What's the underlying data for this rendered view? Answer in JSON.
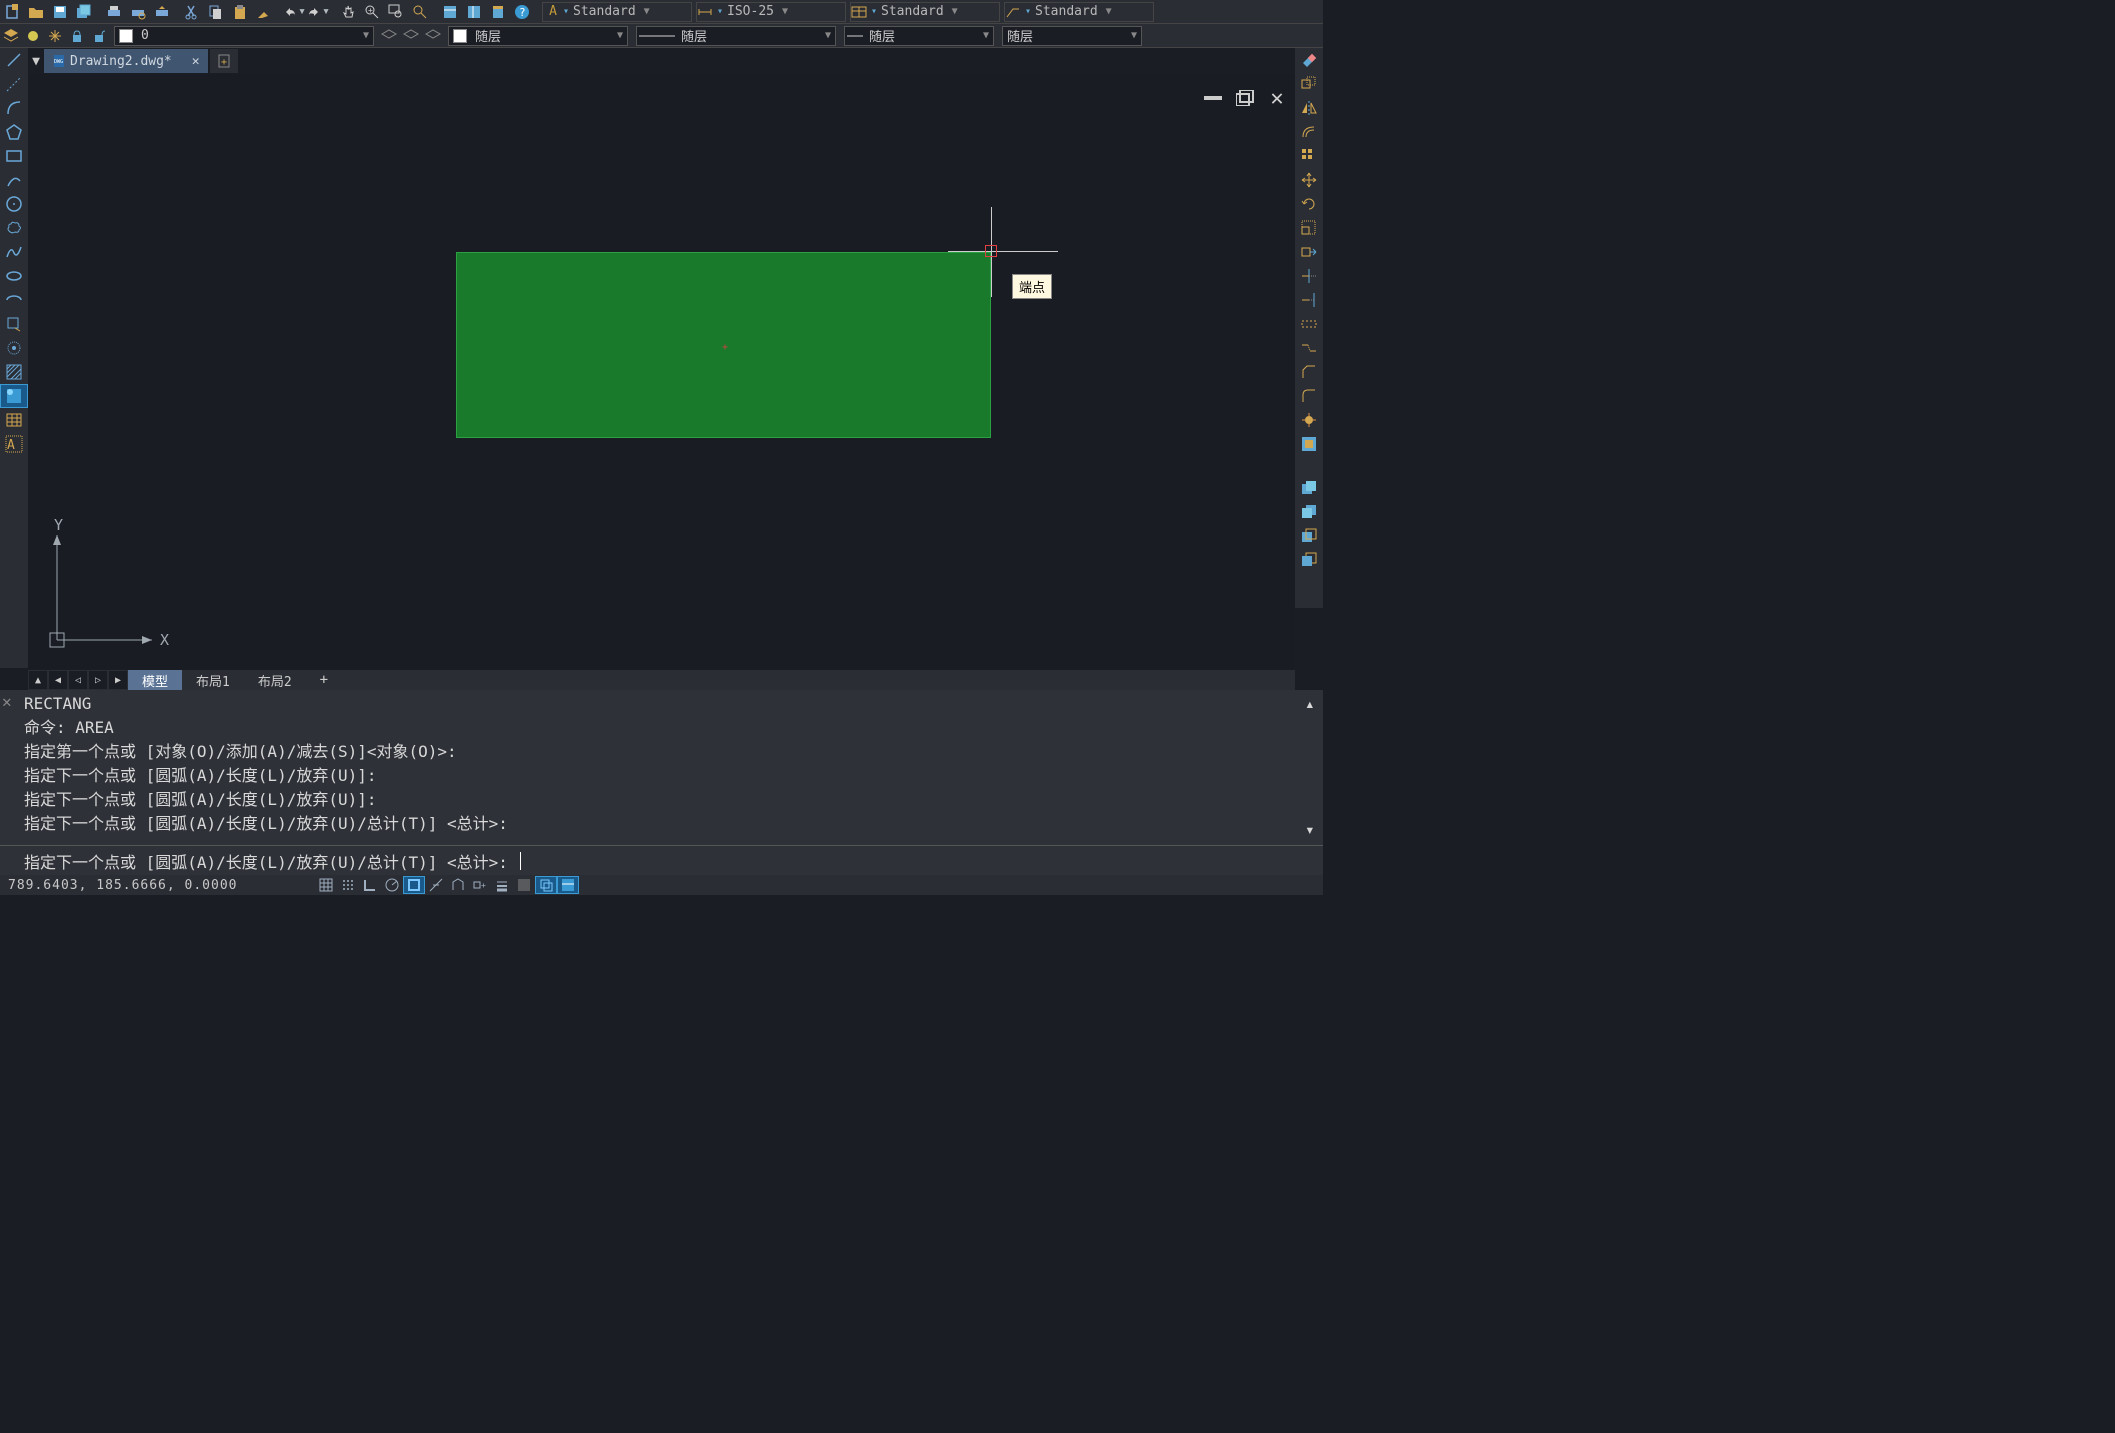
{
  "top_styles": {
    "text_style": "Standard",
    "dim_style": "ISO-25",
    "table_style": "Standard",
    "mleader_style": "Standard"
  },
  "layer": {
    "current": "0",
    "color_prop": "随层",
    "linetype_prop": "随层",
    "lineweight_prop": "随层",
    "plotstyle_prop": "随层"
  },
  "file_tab": {
    "name": "Drawing2.dwg*"
  },
  "tooltip": "端点",
  "layout_tabs": {
    "model": "模型",
    "layout1": "布局1",
    "layout2": "布局2",
    "add": "+"
  },
  "command": {
    "history": [
      "RECTANG",
      "命令: AREA",
      "指定第一个点或 [对象(O)/添加(A)/减去(S)]<对象(O)>:",
      "指定下一个点或 [圆弧(A)/长度(L)/放弃(U)]:",
      "指定下一个点或 [圆弧(A)/长度(L)/放弃(U)]:",
      "指定下一个点或 [圆弧(A)/长度(L)/放弃(U)/总计(T)] <总计>:"
    ],
    "prompt": "指定下一个点或 [圆弧(A)/长度(L)/放弃(U)/总计(T)] <总计>: "
  },
  "status": {
    "coords": "789.6403, 185.6666, 0.0000"
  },
  "ucs": {
    "x": "X",
    "y": "Y"
  }
}
